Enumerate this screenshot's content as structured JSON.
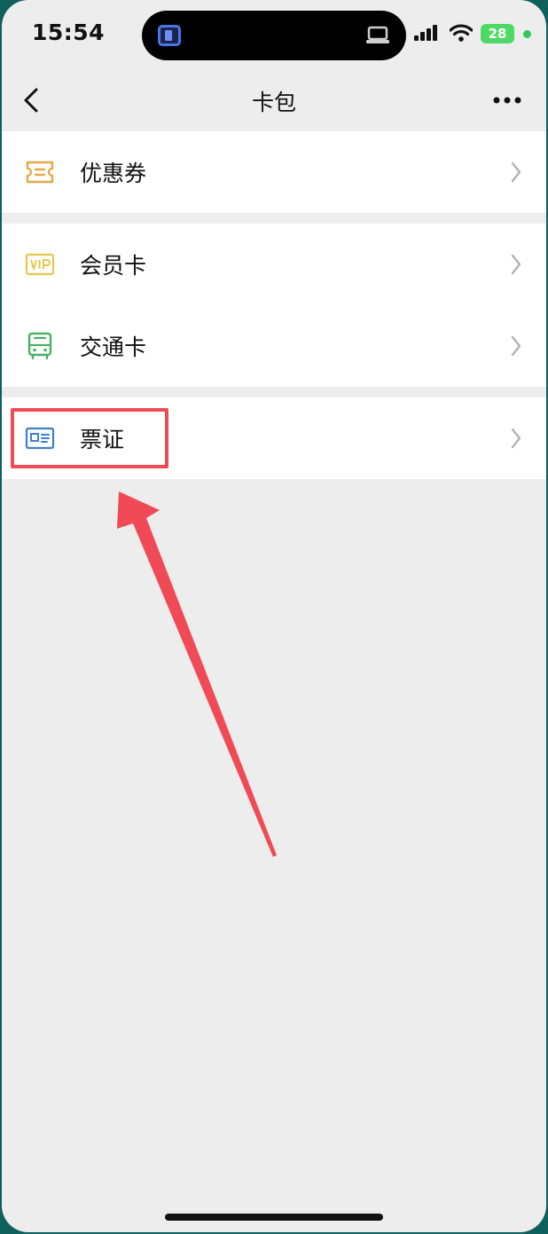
{
  "status_bar": {
    "time": "15:54",
    "battery": "28"
  },
  "nav": {
    "title": "卡包"
  },
  "groups": [
    {
      "items": [
        {
          "label": "优惠券",
          "icon": "coupon-icon",
          "color": "#e8a84a"
        }
      ]
    },
    {
      "items": [
        {
          "label": "会员卡",
          "icon": "vip-card-icon",
          "color": "#e9c64b"
        },
        {
          "label": "交通卡",
          "icon": "bus-icon",
          "color": "#4caf6a"
        }
      ]
    },
    {
      "items": [
        {
          "label": "票证",
          "icon": "id-card-icon",
          "color": "#3f7fd0"
        }
      ]
    }
  ],
  "annotation": {
    "color": "#ef4a55"
  }
}
